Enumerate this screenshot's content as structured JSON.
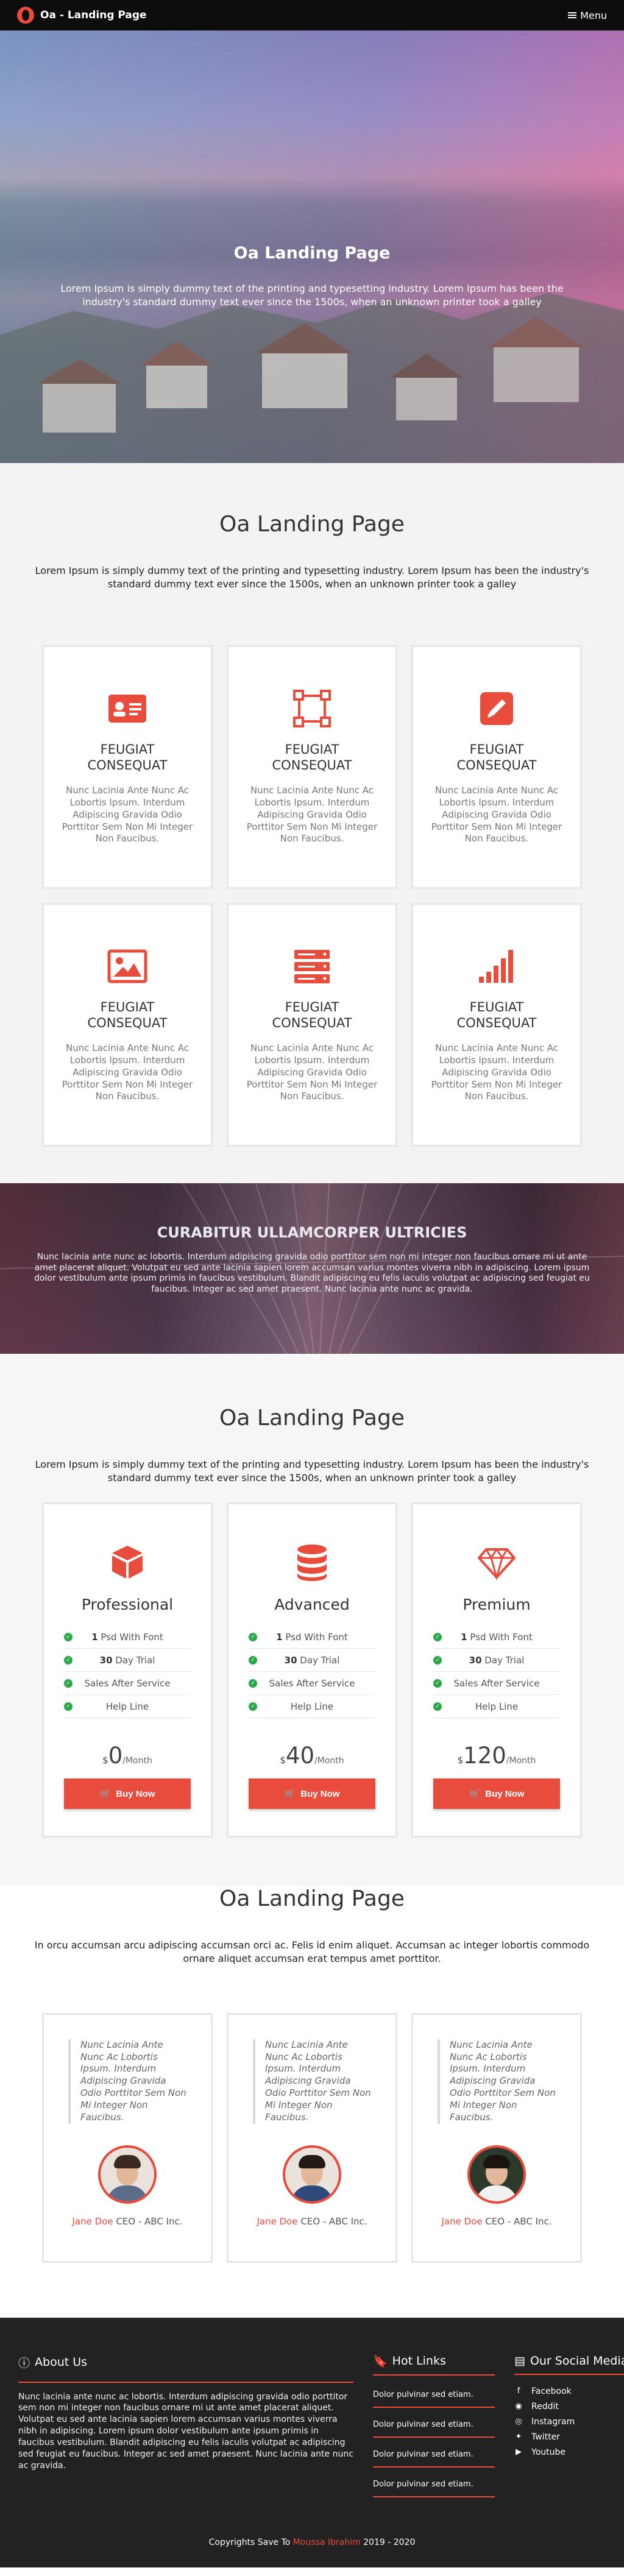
{
  "nav": {
    "brand": "Oa - Landing Page",
    "menu_label": "Menu"
  },
  "hero": {
    "title": "Oa Landing Page",
    "text": "Lorem Ipsum is simply dummy text of the printing and typesetting industry. Lorem Ipsum has been the industry's standard dummy text ever since the 1500s, when an unknown printer took a galley"
  },
  "features": {
    "title": "Oa Landing Page",
    "lead": "Lorem Ipsum is simply dummy text of the printing and typesetting industry. Lorem Ipsum has been the industry's standard dummy text ever since the 1500s, when an unknown printer took a galley",
    "cards": [
      {
        "icon": "id-card-icon",
        "title_1": "FEUGIAT",
        "title_2": "CONSEQUAT",
        "text": "Nunc Lacinia Ante Nunc Ac Lobortis Ipsum. Interdum Adipiscing Gravida Odio Porttitor Sem Non Mi Integer Non Faucibus."
      },
      {
        "icon": "vector-square-icon",
        "title_1": "FEUGIAT",
        "title_2": "CONSEQUAT",
        "text": "Nunc Lacinia Ante Nunc Ac Lobortis Ipsum. Interdum Adipiscing Gravida Odio Porttitor Sem Non Mi Integer Non Faucibus."
      },
      {
        "icon": "pencil-icon",
        "title_1": "FEUGIAT",
        "title_2": "CONSEQUAT",
        "text": "Nunc Lacinia Ante Nunc Ac Lobortis Ipsum. Interdum Adipiscing Gravida Odio Porttitor Sem Non Mi Integer Non Faucibus."
      },
      {
        "icon": "image-icon",
        "title_1": "FEUGIAT",
        "title_2": "CONSEQUAT",
        "text": "Nunc Lacinia Ante Nunc Ac Lobortis Ipsum. Interdum Adipiscing Gravida Odio Porttitor Sem Non Mi Integer Non Faucibus."
      },
      {
        "icon": "server-icon",
        "title_1": "FEUGIAT",
        "title_2": "CONSEQUAT",
        "text": "Nunc Lacinia Ante Nunc Ac Lobortis Ipsum. Interdum Adipiscing Gravida Odio Porttitor Sem Non Mi Integer Non Faucibus."
      },
      {
        "icon": "signal-icon",
        "title_1": "FEUGIAT",
        "title_2": "CONSEQUAT",
        "text": "Nunc Lacinia Ante Nunc Ac Lobortis Ipsum. Interdum Adipiscing Gravida Odio Porttitor Sem Non Mi Integer Non Faucibus."
      }
    ]
  },
  "banner": {
    "title": "CURABITUR ULLAMCORPER ULTRICIES",
    "text": "Nunc lacinia ante nunc ac lobortis. Interdum adipiscing gravida odio porttitor sem non mi integer non faucibus ornare mi ut ante amet placerat aliquet. Volutpat eu sed ante lacinia sapien lorem accumsan varius montes viverra nibh in adipiscing. Lorem ipsum dolor vestibulum ante ipsum primis in faucibus vestibulum. Blandit adipiscing eu felis iaculis volutpat ac adipiscing sed feugiat eu faucibus. Integer ac sed amet praesent. Nunc lacinia ante nunc ac gravida."
  },
  "pricing": {
    "title": "Oa Landing Page",
    "lead": "Lorem Ipsum is simply dummy text of the printing and typesetting industry. Lorem Ipsum has been the industry's standard dummy text ever since the 1500s, when an unknown printer took a galley",
    "plans": [
      {
        "icon": "cube-icon",
        "name": "Professional",
        "f1_num": "1",
        "f1_text": " Psd With Font",
        "f2_num": "30",
        "f2_text": " Day Trial",
        "f3": "Sales After Service",
        "f4": "Help Line",
        "currency": "$",
        "amount": "0",
        "period": "/Month",
        "button": "Buy Now"
      },
      {
        "icon": "database-icon",
        "name": "Advanced",
        "f1_num": "1",
        "f1_text": " Psd With Font",
        "f2_num": "30",
        "f2_text": " Day Trial",
        "f3": "Sales After Service",
        "f4": "Help Line",
        "currency": "$",
        "amount": "40",
        "period": "/Month",
        "button": "Buy Now"
      },
      {
        "icon": "diamond-icon",
        "name": "Premium",
        "f1_num": "1",
        "f1_text": " Psd With Font",
        "f2_num": "30",
        "f2_text": " Day Trial",
        "f3": "Sales After Service",
        "f4": "Help Line",
        "currency": "$",
        "amount": "120",
        "period": "/Month",
        "button": "Buy Now"
      }
    ]
  },
  "testimonials": {
    "title": "Oa Landing Page",
    "lead": "In orcu accumsan arcu adipiscing accumsan orci ac. Felis id enim aliquet. Accumsan ac integer lobortis commodo ornare aliquet accumsan erat tempus amet porttitor.",
    "items": [
      {
        "quote": "Nunc Lacinia Ante Nunc Ac Lobortis Ipsum. Interdum Adipiscing Gravida Odio Porttitor Sem Non Mi Integer Non Faucibus.",
        "name": "Jane Doe",
        "role": "CEO - ABC Inc."
      },
      {
        "quote": "Nunc Lacinia Ante Nunc Ac Lobortis Ipsum. Interdum Adipiscing Gravida Odio Porttitor Sem Non Mi Integer Non Faucibus.",
        "name": "Jane Doe",
        "role": "CEO - ABC Inc."
      },
      {
        "quote": "Nunc Lacinia Ante Nunc Ac Lobortis Ipsum. Interdum Adipiscing Gravida Odio Porttitor Sem Non Mi Integer Non Faucibus.",
        "name": "Jane Doe",
        "role": "CEO - ABC Inc."
      }
    ]
  },
  "footer": {
    "about_title": "About Us",
    "about_text": "Nunc lacinia ante nunc ac lobortis. Interdum adipiscing gravida odio porttitor sem non mi integer non faucibus ornare mi ut ante amet placerat aliquet. Volutpat eu sed ante lacinia sapien lorem accumsan varius montes viverra nibh in adipiscing. Lorem ipsum dolor vestibulum ante ipsum primis in faucibus vestibulum. Blandit adipiscing eu felis iaculis volutpat ac adipiscing sed feugiat eu faucibus. Integer ac sed amet praesent. Nunc lacinia ante nunc ac gravida.",
    "hot_title": "Hot Links",
    "hot_links": [
      "Dolor pulvinar sed etiam.",
      "Dolor pulvinar sed etiam.",
      "Dolor pulvinar sed etiam.",
      "Dolor pulvinar sed etiam."
    ],
    "social_title": "Our Social Media",
    "social": [
      {
        "icon": "facebook-icon",
        "label": "Facebook"
      },
      {
        "icon": "reddit-icon",
        "label": "Reddit"
      },
      {
        "icon": "instagram-icon",
        "label": "Instagram"
      },
      {
        "icon": "twitter-icon",
        "label": "Twitter"
      },
      {
        "icon": "youtube-icon",
        "label": "Youtube"
      }
    ],
    "copy_prefix": "Copyrights Save To ",
    "copy_author": "Moussa Ibrahim",
    "copy_years": " 2019 - 2020"
  },
  "colors": {
    "accent": "#e74c3c",
    "nav_bg": "#0d0d0d",
    "footer_bg": "#222222",
    "check": "#2aa84a"
  }
}
